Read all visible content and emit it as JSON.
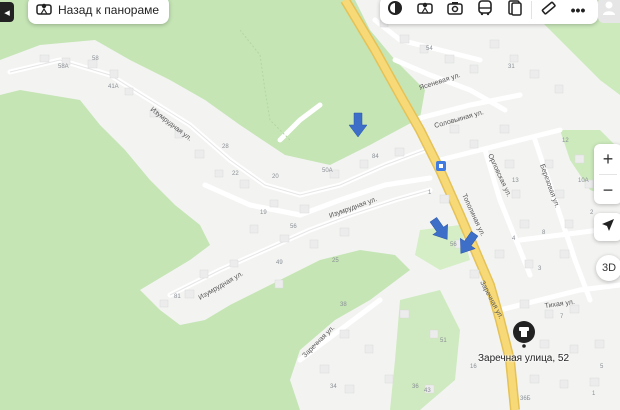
{
  "back_button": {
    "label": "Назад к панораме",
    "icon": "panorama-icon"
  },
  "left_control": {
    "icon": "chevron-left-icon"
  },
  "toolbar": {
    "items": [
      {
        "name": "layers-button",
        "icon": "circle-icon"
      },
      {
        "name": "panorama-mode-button",
        "icon": "panorama-icon"
      },
      {
        "name": "photo-button",
        "icon": "camera-icon"
      },
      {
        "name": "transport-button",
        "icon": "bus-icon"
      },
      {
        "name": "traffic-button",
        "icon": "document-icon"
      },
      {
        "name": "ruler-button",
        "icon": "ruler-icon"
      },
      {
        "name": "more-button",
        "icon": "more-dots-icon"
      }
    ]
  },
  "profile": {
    "icon": "user-icon"
  },
  "zoom": {
    "in": "+",
    "out": "−"
  },
  "locate": {
    "icon": "navigation-arrow-icon"
  },
  "view_3d": {
    "label": "3D"
  },
  "streets": {
    "izumrudnaya_1": "Изумрудная ул.",
    "izumrudnaya_2": "Изумрудная ул.",
    "izumrudnaya_3": "Изумрудная ул.",
    "yasenevaya": "Ясеневая ул.",
    "solovinaya": "Соловьиная ул.",
    "topolinaya": "Тополиная ул.",
    "orlovskaya": "Орловская ул.",
    "berezovaya": "Березовая ул.",
    "zarechnaya": "Заречная ул.",
    "zarechnaya_2": "Заречная ул.",
    "tikhaya": "Тихая ул."
  },
  "house_numbers": [
    "58А",
    "58",
    "41А",
    "28",
    "22",
    "20",
    "19",
    "56",
    "49",
    "25",
    "81",
    "38",
    "50А",
    "84",
    "54",
    "31",
    "12",
    "10А",
    "2",
    "13",
    "4",
    "8",
    "1",
    "3",
    "7",
    "5",
    "1",
    "36",
    "34",
    "43",
    "36Б",
    "16",
    "51",
    "56"
  ],
  "poi": {
    "label": "Заречная улица, 52",
    "icon": "toilet-icon"
  },
  "markers": [
    {
      "name": "blue-arrow-icon",
      "direction": "down"
    },
    {
      "name": "blue-arrow-icon",
      "direction": "down-right"
    },
    {
      "name": "blue-arrow-icon",
      "direction": "down-left"
    }
  ],
  "colors": {
    "forest": "#c7e7b7",
    "urban": "#f4f4f4",
    "road_main": "#f5d36b",
    "road_minor": "#ffffff",
    "marker": "#3d6fc9"
  }
}
